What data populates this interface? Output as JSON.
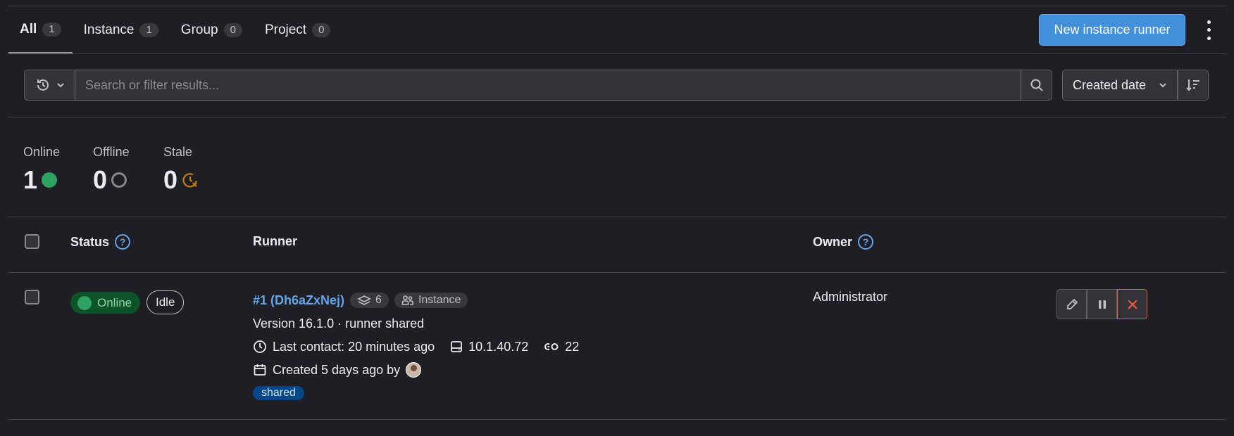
{
  "tabs": [
    {
      "label": "All",
      "count": "1",
      "active": true
    },
    {
      "label": "Instance",
      "count": "1"
    },
    {
      "label": "Group",
      "count": "0"
    },
    {
      "label": "Project",
      "count": "0"
    }
  ],
  "header": {
    "new_runner_label": "New instance runner"
  },
  "search": {
    "placeholder": "Search or filter results..."
  },
  "sort": {
    "label": "Created date"
  },
  "stats": {
    "online": {
      "label": "Online",
      "value": "1"
    },
    "offline": {
      "label": "Offline",
      "value": "0"
    },
    "stale": {
      "label": "Stale",
      "value": "0"
    }
  },
  "table": {
    "headers": {
      "status": "Status",
      "runner": "Runner",
      "owner": "Owner"
    },
    "row": {
      "status": "Online",
      "state": "Idle",
      "runner_name": "#1 (Dh6aZxNej)",
      "jobs": "6",
      "type": "Instance",
      "version": "Version 16.1.0 · runner shared",
      "last_contact": "Last contact: 20 minutes ago",
      "ip": "10.1.40.72",
      "jobs_count": "22",
      "created": "Created 5 days ago by",
      "tag": "shared",
      "owner": "Administrator"
    }
  },
  "colors": {
    "accent": "#428fdc",
    "online": "#2da160",
    "stale": "#c17d10",
    "danger": "#ec5941"
  }
}
